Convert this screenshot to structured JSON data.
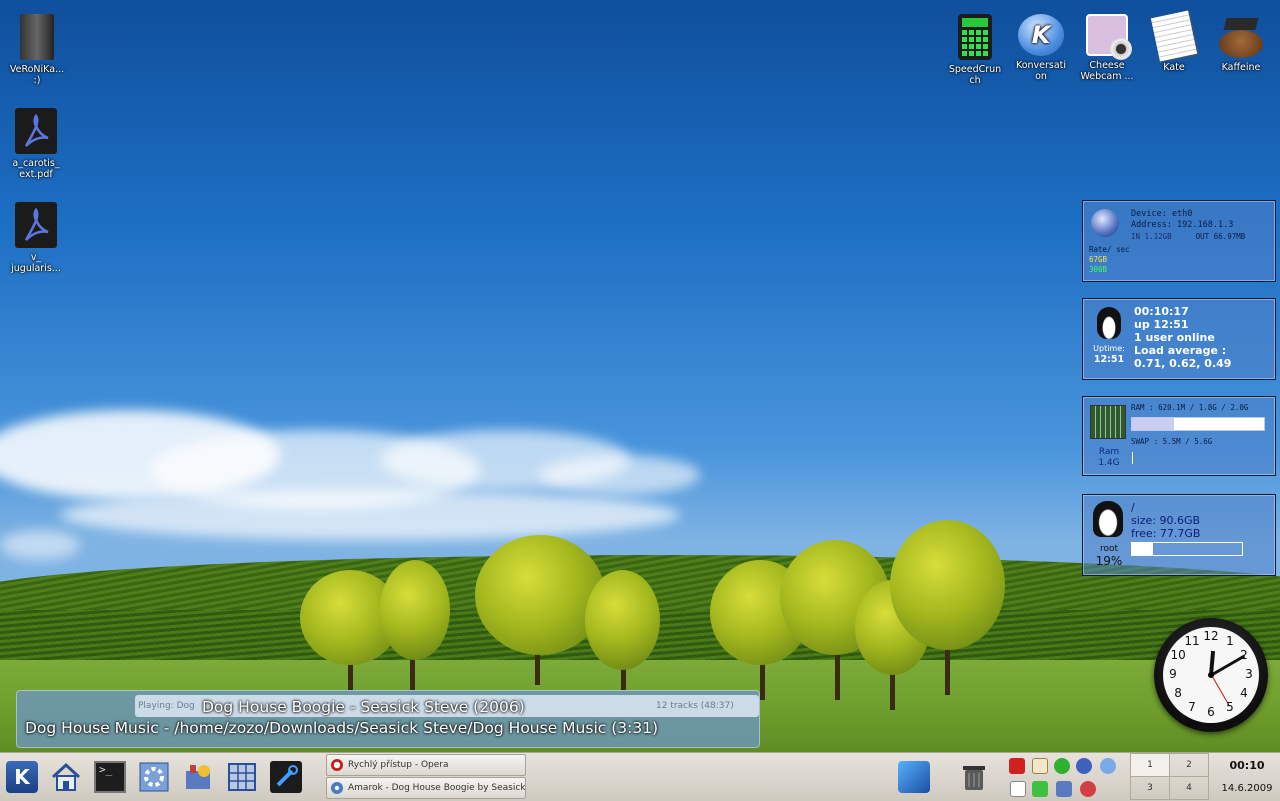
{
  "desktop_icons_left": [
    {
      "label_line1": "VeRoNiKa...",
      "label_line2": ":)"
    },
    {
      "label_line1": "a_carotis_",
      "label_line2": "ext.pdf"
    },
    {
      "label_line1": "v_",
      "label_line2": "jugularis..."
    }
  ],
  "desktop_icons_right": [
    {
      "label_line1": "SpeedCrun",
      "label_line2": "ch",
      "icon": "calculator-icon"
    },
    {
      "label_line1": "Konversati",
      "label_line2": "on",
      "icon": "chat-bubble-icon"
    },
    {
      "label_line1": "Cheese",
      "label_line2": "Webcam ...",
      "icon": "webcam-icon"
    },
    {
      "label_line1": "Kate",
      "label_line2": "",
      "icon": "text-editor-icon"
    },
    {
      "label_line1": "Kaffeine",
      "label_line2": "",
      "icon": "media-player-icon"
    }
  ],
  "network_widget": {
    "device": "Device:  eth0",
    "address": "Address:  192.168.1.3",
    "in": "IN  1.12GB",
    "out": "OUT  66.97MB",
    "rate_label": "Rate/ sec",
    "rate1": "67GB",
    "rate2": "300B"
  },
  "uptime_widget": {
    "time": "00:10:17",
    "up": "up 12:51",
    "users": "1 user online",
    "load_label": "Load average :",
    "load_values": "0.71, 0.62, 0.49",
    "side_label": "Uptime:",
    "side_value": "12:51"
  },
  "ram_widget": {
    "ram": "RAM : 620.1M / 1.8G / 2.0G",
    "swap": "SWAP : 5.5M / 5.6G",
    "side_label": "Ram",
    "side_value": "1.4G",
    "ram_fill": 0.32,
    "swap_fill": 0.01
  },
  "disk_widget": {
    "mount": "/",
    "size": "size: 90.6GB",
    "free": "free: 77.7GB",
    "side_label": "root",
    "side_value": "19%",
    "used_fill": 0.19
  },
  "clock": {
    "numbers": [
      "12",
      "1",
      "2",
      "3",
      "4",
      "5",
      "6",
      "7",
      "8",
      "9",
      "10",
      "11"
    ],
    "time": "00:10"
  },
  "osd": {
    "playing_label": "Playing: Dog",
    "line1": "Dog House Boogie - Seasick Steve (2006)",
    "tracks": "12 tracks (48:37)",
    "line2": "Dog House Music - /home/zozo/Downloads/Seasick Steve/Dog House Music (3:31)"
  },
  "taskbar": {
    "tasks": [
      {
        "label": "Rychlý přístup - Opera"
      },
      {
        "label": "Amarok - Dog House Boogie by Seasick Steve"
      }
    ],
    "pager": [
      "1",
      "2",
      "3",
      "4"
    ],
    "clock_time": "00:10",
    "clock_date": "14.6.2009"
  },
  "colors": {
    "sky_top": "#0f4f9c",
    "widget_bg": "#5082c8",
    "taskbar": "#dcd8d0"
  }
}
